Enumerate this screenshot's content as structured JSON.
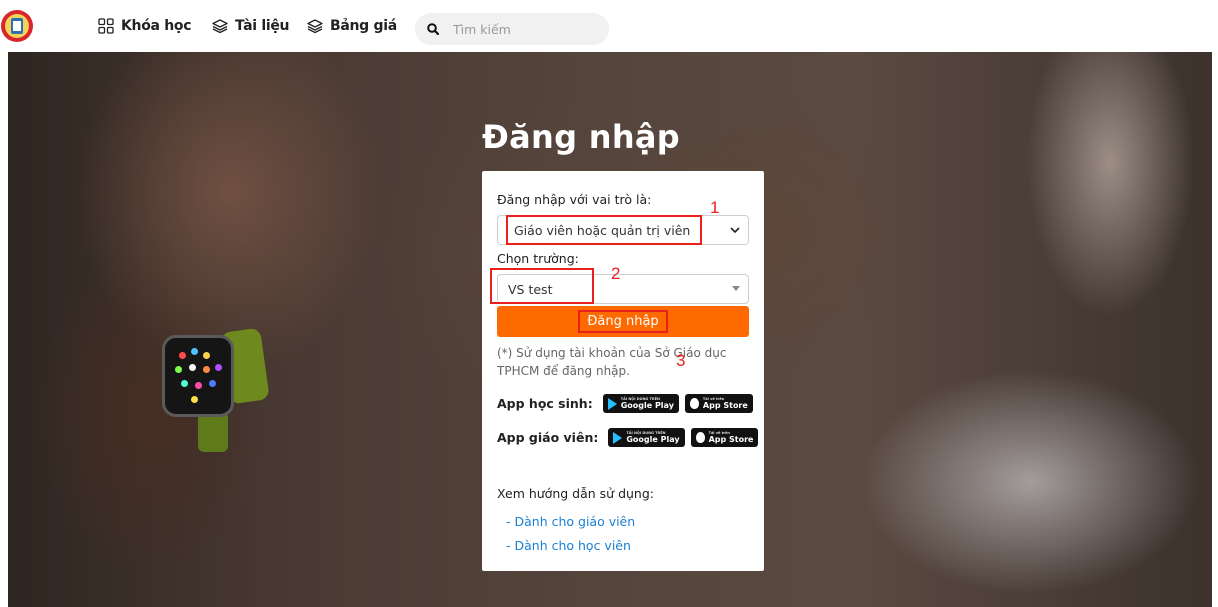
{
  "nav": {
    "items": [
      {
        "label": "Khóa học",
        "icon": "grid-icon"
      },
      {
        "label": "Tài liệu",
        "icon": "layers-icon"
      },
      {
        "label": "Bảng giá",
        "icon": "layers-icon"
      }
    ],
    "search_placeholder": "Tìm kiếm"
  },
  "login": {
    "title": "Đăng nhập",
    "role_label": "Đăng nhập với vai trò là:",
    "role_value": "Giáo viên hoặc quản trị viên",
    "school_label": "Chọn trường:",
    "school_value": "VS test",
    "submit_label": "Đăng nhập",
    "note": "(*) Sử dụng tài khoản của Sở Giáo dục TPHCM để đăng nhập."
  },
  "apps": {
    "student_label": "App học sinh:",
    "teacher_label": "App giáo viên:",
    "google_small": "TẢI NỘI DUNG TRÊN",
    "google_big": "Google Play",
    "apple_small": "Tải về trên",
    "apple_big": "App Store"
  },
  "guide": {
    "title": "Xem hướng dẫn sử dụng:",
    "links": [
      "- Dành cho giáo viên",
      "- Dành cho học viên"
    ]
  },
  "annotations": [
    "1",
    "2",
    "3"
  ],
  "colors": {
    "accent": "#ff6a00",
    "annotation": "#e8221b",
    "link": "#1a7fd4"
  }
}
